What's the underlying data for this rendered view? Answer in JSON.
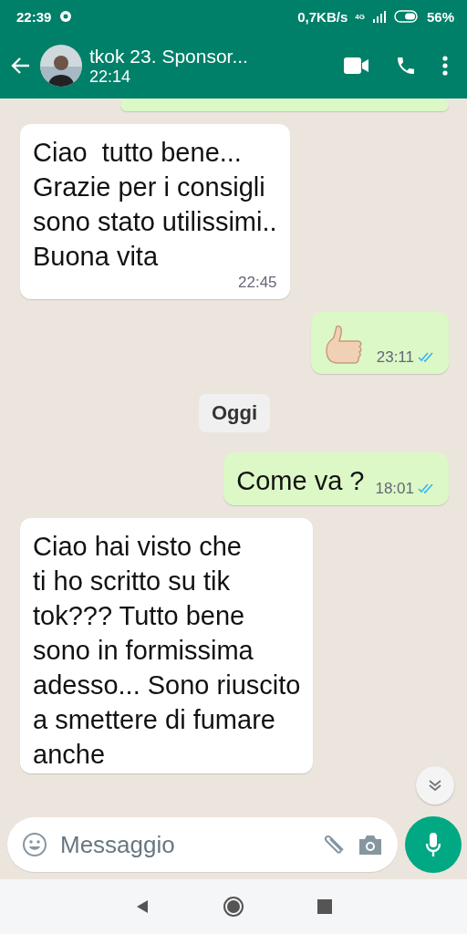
{
  "status_bar": {
    "time": "22:39",
    "speed": "0,7KB/s",
    "network": "4G",
    "battery": "56%"
  },
  "header": {
    "name": "tkok 23. Sponsor...",
    "last_seen": "22:14"
  },
  "messages": [
    {
      "kind": "stub",
      "outgoing": true
    },
    {
      "kind": "text",
      "outgoing": false,
      "lines": [
        "Ciao  tutto bene...",
        "Grazie per i consigli",
        "sono stato utilissimi..",
        "Buona vita"
      ],
      "time": "22:45"
    },
    {
      "kind": "emoji",
      "outgoing": true,
      "time": "23:11",
      "read": true
    },
    {
      "kind": "date",
      "label": "Oggi"
    },
    {
      "kind": "text",
      "outgoing": true,
      "lines": [
        "Come va ?"
      ],
      "time": "18:01",
      "read": true
    },
    {
      "kind": "text",
      "outgoing": false,
      "lines": [
        "Ciao hai visto che",
        "ti ho scritto su tik",
        "tok??? Tutto bene",
        "sono in formissima",
        "adesso... Sono riuscito",
        "a smettere di fumare",
        "anche"
      ]
    }
  ],
  "composer": {
    "placeholder": "Messaggio"
  }
}
